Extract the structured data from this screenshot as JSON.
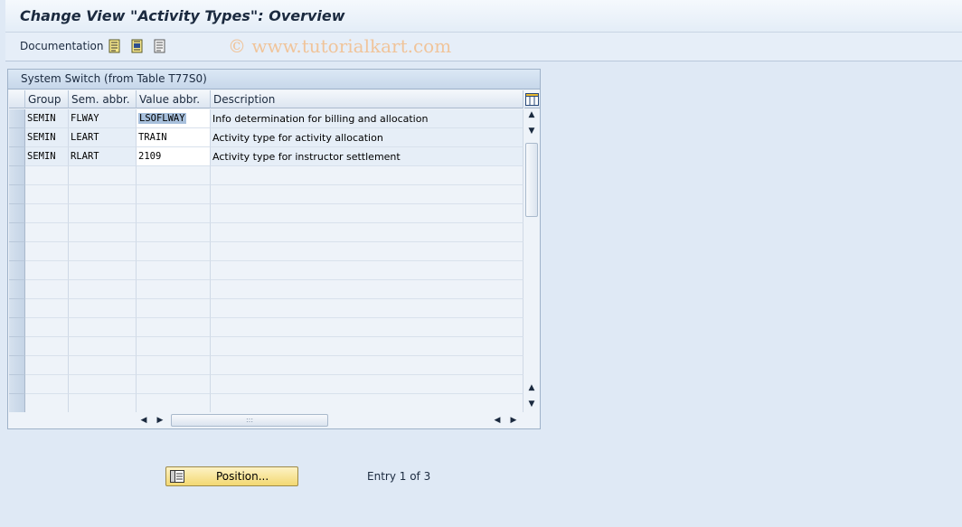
{
  "title": "Change View \"Activity Types\": Overview",
  "toolbar": {
    "documentation_label": "Documentation",
    "icons": [
      "select-all-icon",
      "select-block-icon",
      "deselect-all-icon"
    ]
  },
  "watermark": "© www.tutorialkart.com",
  "panel": {
    "title": "System Switch (from Table T77S0)"
  },
  "table": {
    "columns": [
      "Group",
      "Sem. abbr.",
      "Value abbr.",
      "Description"
    ],
    "rows": [
      {
        "group": "SEMIN",
        "sem": "FLWAY",
        "value": "LSOFLWAY",
        "desc": "Info determination for billing and allocation"
      },
      {
        "group": "SEMIN",
        "sem": "LEART",
        "value": "TRAIN",
        "desc": "Activity type for activity allocation"
      },
      {
        "group": "SEMIN",
        "sem": "RLART",
        "value": "2109",
        "desc": "Activity type for instructor settlement"
      }
    ]
  },
  "position_button": "Position...",
  "entry_text": "Entry 1 of 3",
  "colors": {
    "background": "#dfe9f5",
    "button": "#f3d872",
    "selection": "#a8c0dc"
  }
}
